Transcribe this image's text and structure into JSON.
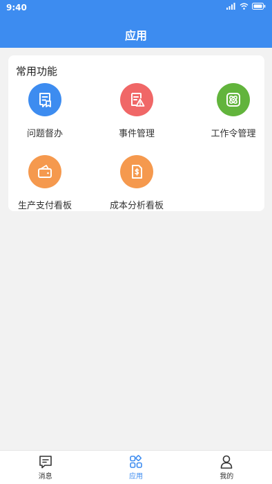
{
  "status_bar": {
    "time": "9:40",
    "icons": [
      "signal-icon",
      "wifi-icon",
      "battery-icon"
    ]
  },
  "header": {
    "title": "应用",
    "background": "#3d8cf0"
  },
  "card": {
    "title": "常用功能",
    "apps": [
      {
        "label": "问题督办",
        "icon": "document-icon",
        "color": "#3d8cf0"
      },
      {
        "label": "事件管理",
        "icon": "warning-document-icon",
        "color": "#f06767"
      },
      {
        "label": "工作令管理",
        "icon": "atom-icon",
        "color": "#62b43c"
      },
      {
        "label": "生产支付看板",
        "icon": "wallet-icon",
        "color": "#f5994e"
      },
      {
        "label": "成本分析看板",
        "icon": "dollar-document-icon",
        "color": "#f5994e"
      }
    ]
  },
  "bottom_nav": {
    "active_color": "#3d8cf0",
    "items": [
      {
        "label": "消息",
        "icon": "message-icon"
      },
      {
        "label": "应用",
        "icon": "apps-icon"
      },
      {
        "label": "我的",
        "icon": "user-icon"
      }
    ]
  }
}
